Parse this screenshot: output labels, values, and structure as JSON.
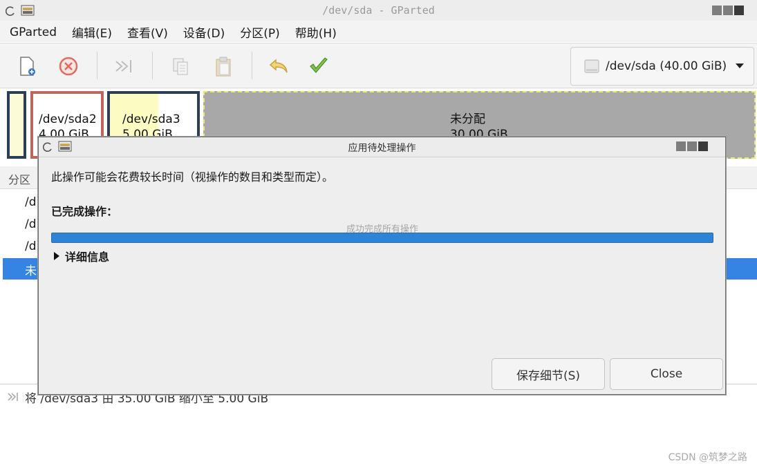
{
  "window": {
    "title": "/dev/sda - GParted"
  },
  "menu": [
    "GParted",
    "编辑(E)",
    "查看(V)",
    "设备(D)",
    "分区(P)",
    "帮助(H)"
  ],
  "toolbar": {
    "icons": [
      "new-partition-icon",
      "delete-icon",
      "resize-move-icon",
      "copy-icon",
      "paste-icon",
      "undo-icon",
      "apply-icon"
    ],
    "device": "/dev/sda (40.00 GiB)"
  },
  "partitions": {
    "sda2": {
      "name": "/dev/sda2",
      "size": "4.00 GiB",
      "border": "#c0655a"
    },
    "sda3": {
      "name": "/dev/sda3",
      "size": "5.00 GiB",
      "border": "#2b3e55"
    },
    "unallocated": {
      "name": "未分配",
      "size": "30.00 GiB"
    }
  },
  "list": {
    "header_fragment": "分区",
    "rows": [
      "/d",
      "/d",
      "/d",
      "未"
    ]
  },
  "pending": {
    "fragment": "将 /dev/sda3 由 35.00 GiB 缩小至 5.00 GiB"
  },
  "dialog": {
    "title": "应用待处理操作",
    "message": "此操作可能会花费较长时间（视操作的数目和类型而定）。",
    "completed_label": "已完成操作：",
    "status": "成功完成所有操作",
    "progress": 1.0,
    "details_label": "详细信息",
    "save_button": "保存细节(S)",
    "close_button": "Close"
  },
  "watermark": "CSDN @筑梦之路"
}
